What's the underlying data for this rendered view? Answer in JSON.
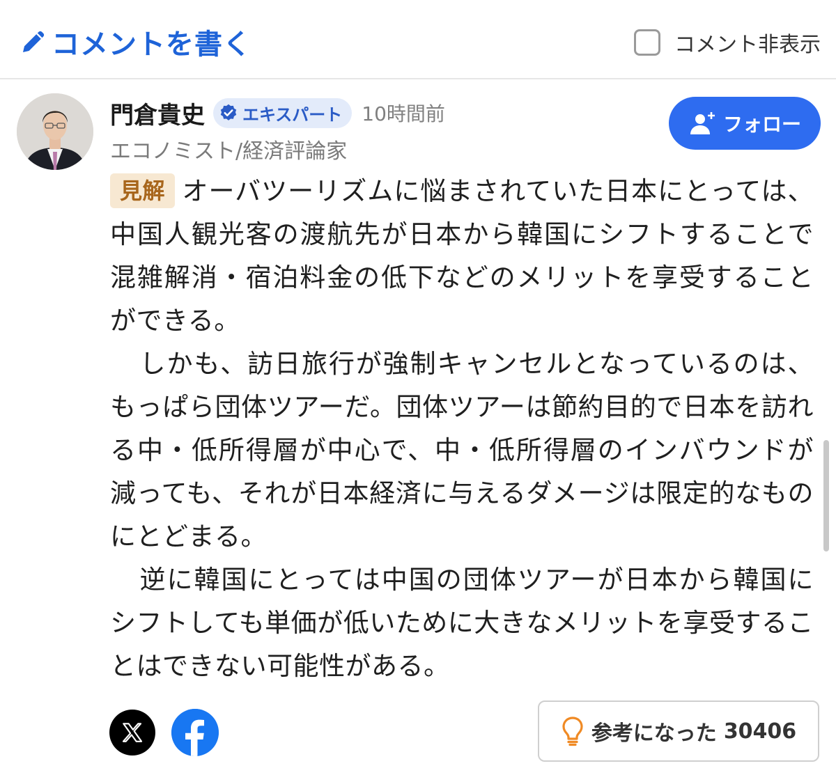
{
  "header": {
    "write_label": "コメントを書く",
    "hide_label": "コメント非表示"
  },
  "author": {
    "name": "門倉貴史",
    "badge": "エキスパート",
    "time": "10時間前",
    "title": "エコノミスト/経済評論家",
    "follow_label": "フォロー"
  },
  "comment": {
    "tag": "見解",
    "paragraphs": [
      "オーバツーリズムに悩まされていた日本にとっては、中国人観光客の渡航先が日本から韓国にシフトすることで混雑解消・宿泊料金の低下などのメリットを享受することができる。",
      "しかも、訪日旅行が強制キャンセルとなっているのは、もっぱら団体ツアーだ。団体ツアーは節約目的で日本を訪れる中・低所得層が中心で、中・低所得層のインバウンドが減っても、それが日本経済に与えるダメージは限定的なものにとどまる。",
      "逆に韓国にとっては中国の団体ツアーが日本から韓国にシフトしても単価が低いために大きなメリットを享受することはできない可能性がある。"
    ]
  },
  "footer": {
    "helpful_label": "参考になった",
    "helpful_count": "30406"
  },
  "colors": {
    "accent": "#1e63d8",
    "follow_bg": "#2e6cf0",
    "tag_bg": "#f7e8d2",
    "tag_text": "#a8661c",
    "facebook": "#1877f2",
    "bulb": "#f08a24"
  },
  "icons": [
    "pencil-icon",
    "checkbox",
    "verified-icon",
    "add-user-icon",
    "x-logo-icon",
    "facebook-logo-icon",
    "lightbulb-icon"
  ]
}
